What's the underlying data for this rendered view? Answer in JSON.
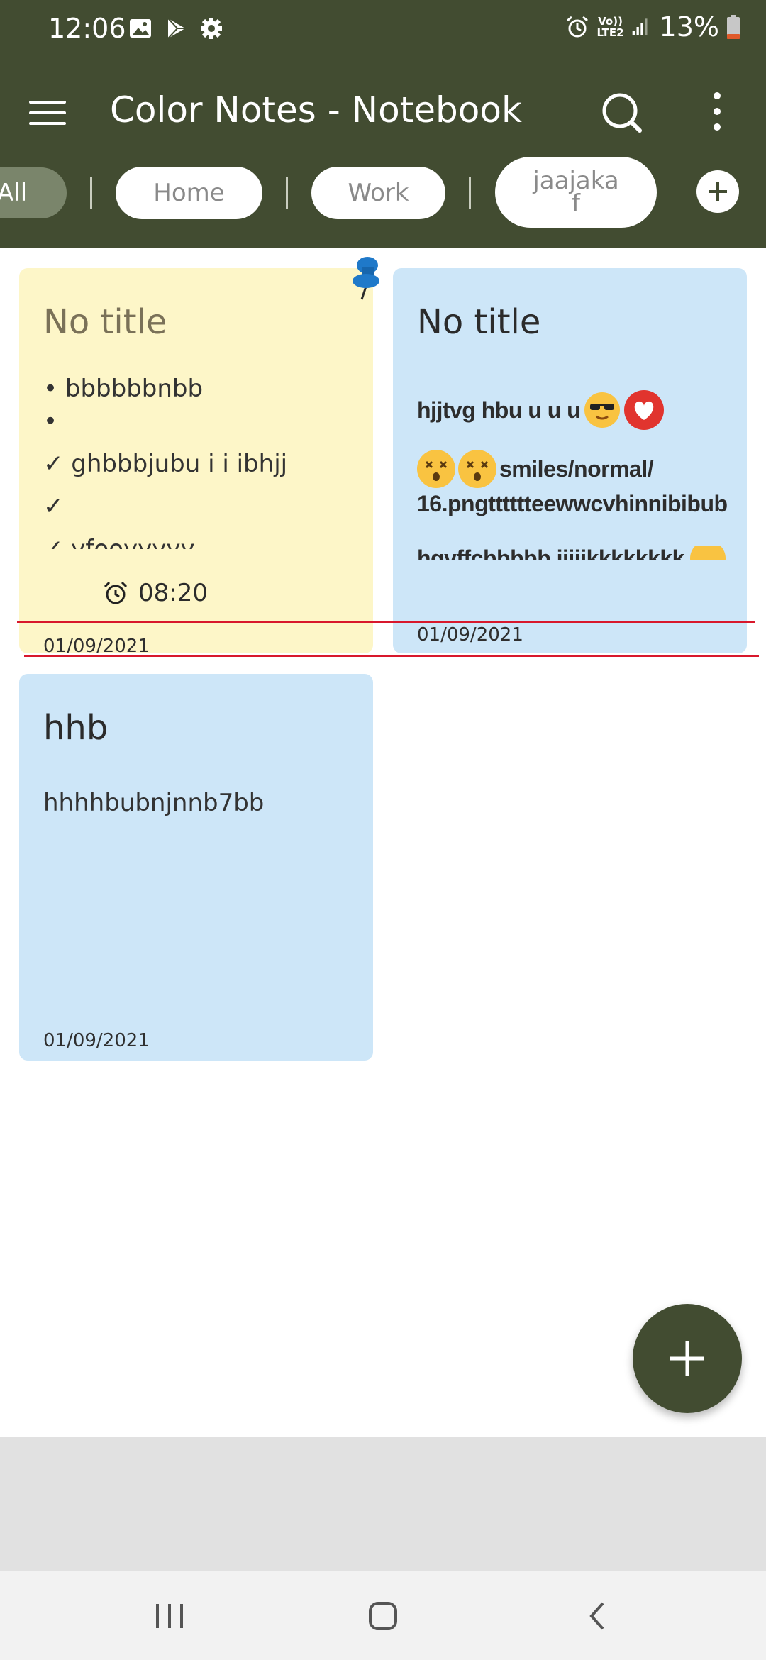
{
  "status_bar": {
    "time": "12:06",
    "network_label_line1": "Vo))",
    "network_label_line2": "LTE2",
    "battery": "13%"
  },
  "app_bar": {
    "title": "Color Notes - Notebook",
    "menu_icon": "hamburger-menu-icon",
    "search_icon": "search-icon",
    "more_icon": "more-vert-icon"
  },
  "tabs": [
    {
      "label": "All",
      "selected": true
    },
    {
      "label": "Home"
    },
    {
      "label": "Work"
    },
    {
      "label": "jaajaka f"
    }
  ],
  "notes": [
    {
      "title": "No title",
      "color": "#fdf6c8",
      "pinned": true,
      "lines": [
        "• bbbbbbnbb",
        "•",
        "✓ ghbbbjubu i i ibhjj",
        "✓",
        "✓ vfooyyyyy"
      ],
      "reminder": "08:20",
      "date": "01/09/2021"
    },
    {
      "title": "No title",
      "color": "#cde6f8",
      "lines": [
        "hjjtvg hbu u u u",
        "smiles/normal/",
        "16.pngtttttteewwcvhinnibibub",
        "hgvffcbbbbb iiiijkkkkkkkk"
      ],
      "date": "01/09/2021"
    },
    {
      "title": "hhb",
      "color": "#cde6f8",
      "lines": [
        "hhhhbubnjnnb7bb"
      ],
      "date": "01/09/2021"
    }
  ],
  "fab_icon": "add-icon"
}
